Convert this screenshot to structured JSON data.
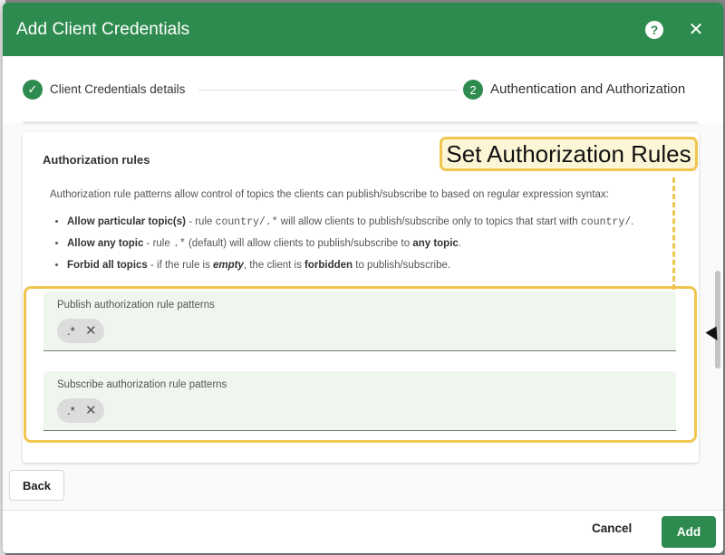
{
  "dialog": {
    "title": "Add Client Credentials",
    "help_icon": "help-icon",
    "close_icon": "close-icon",
    "header_color": "#2e8b4f"
  },
  "stepper": {
    "steps": [
      {
        "number": "✓",
        "label": "Client Credentials details",
        "state": "completed"
      },
      {
        "number": "2",
        "label": "Authentication and Authorization",
        "state": "active"
      }
    ]
  },
  "card": {
    "title": "Authorization rules",
    "callout": "Set Authorization Rules",
    "description": "Authorization rule patterns allow control of topics the clients can publish/subscribe to based on regular expression syntax:",
    "rules": [
      {
        "bold": "Allow particular topic(s)",
        "text_before": " - rule ",
        "code": "country/.*",
        "text_after": " will allow clients to publish/subscribe only to topics that start with ",
        "code2": "country/",
        "text_end": "."
      },
      {
        "bold": "Allow any topic",
        "text_before": " - rule ",
        "code": ".*",
        "text_after": " (default) will allow clients to publish/subscribe to ",
        "bold2": "any topic",
        "text_end": "."
      },
      {
        "bold": "Forbid all topics",
        "text_before": " - if the rule is ",
        "emph": "empty",
        "text_after": ", the client is ",
        "bold2": "forbidden",
        "text_end": " to publish/subscribe."
      }
    ],
    "publish_field": {
      "label": "Publish authorization rule patterns",
      "chips": [
        ".*"
      ]
    },
    "subscribe_field": {
      "label": "Subscribe authorization rule patterns",
      "chips": [
        ".*"
      ]
    }
  },
  "buttons": {
    "back": "Back",
    "cancel": "Cancel",
    "add": "Add"
  }
}
